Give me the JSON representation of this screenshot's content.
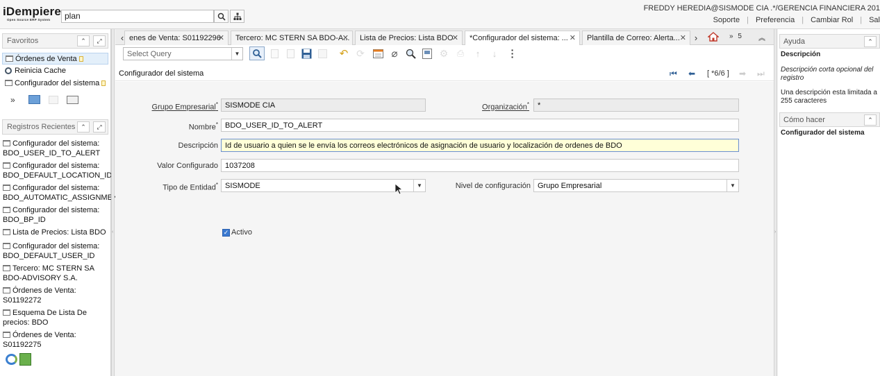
{
  "header": {
    "logo_text": "iDempiere",
    "logo_subtitle": "Open Source ERP System",
    "search_value": "plan",
    "user_info": "FREDDY HEREDIA@SISMODE CIA .*/GERENCIA FINANCIERA 201",
    "links": [
      "Soporte",
      "Preferencia",
      "Cambiar Rol",
      "Sal"
    ]
  },
  "favorites": {
    "title": "Favoritos",
    "items": [
      {
        "label": "Órdenes de Venta",
        "icon": "window-icon",
        "selected": true
      },
      {
        "label": "Reinicia Cache",
        "icon": "gear-icon",
        "selected": false
      },
      {
        "label": "Configurador del sistema",
        "icon": "window-icon",
        "selected": false
      }
    ]
  },
  "recent": {
    "title": "Registros Recientes",
    "items": [
      "Configurador del sistema: BDO_USER_ID_TO_ALERT",
      "Configurador del sistema: BDO_DEFAULT_LOCATION_ID",
      "Configurador del sistema: BDO_AUTOMATIC_ASSIGNMENT",
      "Configurador del sistema: BDO_BP_ID",
      "Lista de Precios: Lista BDO",
      "Configurador del sistema: BDO_DEFAULT_USER_ID",
      "Tercero: MC STERN SA BDO-ADVISORY S.A.",
      "Órdenes de Venta: S01192272",
      "Esquema De Lista De precios: BDO",
      "Órdenes de Venta: S01192275"
    ]
  },
  "tabs": [
    {
      "label": "enes de Venta: S01192296",
      "active": false
    },
    {
      "label": "Tercero: MC STERN SA BDO-A...",
      "active": false
    },
    {
      "label": "Lista de Precios: Lista BDO",
      "active": false
    },
    {
      "label": "*Configurador del sistema: ...",
      "active": true
    },
    {
      "label": "Plantilla de Correo: Alerta...",
      "active": false
    }
  ],
  "tab_count": "5",
  "toolbar": {
    "select_query_placeholder": "Select Query"
  },
  "window": {
    "title": "Configurador del sistema",
    "record_counter": "[ *6/6 ]"
  },
  "form": {
    "grupo_empresarial": {
      "label": "Grupo Empresarial",
      "value": "SISMODE CIA"
    },
    "organizacion": {
      "label": "Organización",
      "value": "*"
    },
    "nombre": {
      "label": "Nombre",
      "value": "BDO_USER_ID_TO_ALERT"
    },
    "descripcion": {
      "label": "Descripción",
      "value": "Id de usuario a quien se le envía los correos electrónicos de asignación de usuario y localización de ordenes de BDO"
    },
    "valor_configurado": {
      "label": "Valor Configurado",
      "value": "1037208"
    },
    "tipo_entidad": {
      "label": "Tipo de Entidad",
      "value": "SISMODE"
    },
    "nivel_configuracion": {
      "label": "Nivel de configuración",
      "value": "Grupo Empresarial"
    },
    "activo": {
      "label": "Activo",
      "checked": true
    }
  },
  "help": {
    "title": "Ayuda",
    "desc_heading": "Descripción",
    "desc_text": "Descripción corta opcional del registro",
    "desc_note": "Una descripción esta limitada a 255 caracteres",
    "howto_title": "Cómo hacer",
    "howto_text": "Configurador del sistema"
  },
  "colors": {
    "accent": "#2b5fae",
    "focus_field": "#ffffd8"
  }
}
